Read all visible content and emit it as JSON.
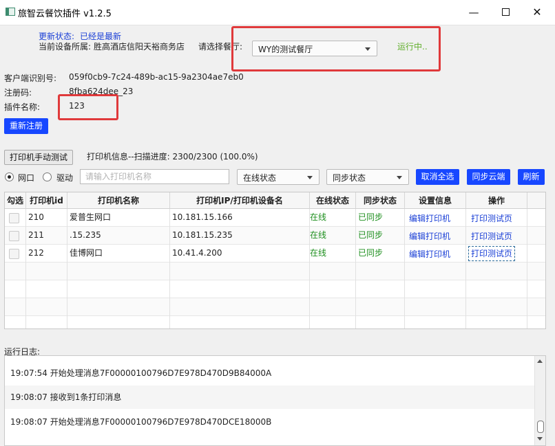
{
  "window": {
    "title": "旅智云餐饮插件 v1.2.5",
    "min_glyph": "—",
    "close_glyph": "✕"
  },
  "status": {
    "update_label": "更新状态:",
    "update_value": "已经是最新",
    "device_label": "当前设备所属:",
    "device_value": "胜高酒店信阳天裕商务店",
    "restaurant_label": "请选择餐厅:",
    "restaurant_selected": "WY的测试餐厅",
    "running_text": "运行中.."
  },
  "info": {
    "client_id_label": "客户端识别号:",
    "client_id_value": "059f0cb9-7c24-489b-ac15-9a2304ae7eb0",
    "reg_code_label": "注册码:",
    "reg_code_value": "8fba624dee_23",
    "plugin_name_label": "插件名称:",
    "plugin_name_value": "123",
    "reregister_label": "重新注册"
  },
  "printer_toolbar": {
    "manual_test_label": "打印机手动测试",
    "scan_info": "打印机信息--扫描进度: 2300/2300 (100.0%)",
    "radio_network": "网口",
    "radio_driver": "驱动",
    "radio_selected": "network",
    "search_placeholder": "请输入打印机名称",
    "online_filter": "在线状态",
    "sync_filter": "同步状态",
    "deselect_all_label": "取消全选",
    "sync_cloud_label": "同步云端",
    "refresh_label": "刷新"
  },
  "table": {
    "headers": [
      "勾选",
      "打印机id",
      "打印机名称",
      "打印机IP/打印机设备名",
      "在线状态",
      "同步状态",
      "设置信息",
      "操作"
    ],
    "rows": [
      {
        "id": "210",
        "name": "爱普生网口",
        "ip": "10.181.15.166",
        "online": "在线",
        "sync": "已同步",
        "settings": "编辑打印机",
        "action": "打印测试页"
      },
      {
        "id": "211",
        "name": ".15.235",
        "ip": "10.181.15.235",
        "online": "在线",
        "sync": "已同步",
        "settings": "编辑打印机",
        "action": "打印测试页"
      },
      {
        "id": "212",
        "name": "佳博网口",
        "ip": "10.41.4.200",
        "online": "在线",
        "sync": "已同步",
        "settings": "编辑打印机",
        "action": "打印测试页"
      }
    ]
  },
  "log": {
    "label": "运行日志:",
    "entries": [
      "19:07:54 开始处理消息7F00000100796D7E978D470D9B84000A",
      "19:08:07 接收到1条打印消息",
      "19:08:07 开始处理消息7F00000100796D7E978D470DCE18000B"
    ]
  },
  "colors": {
    "accent_blue": "#1747ff",
    "status_green": "#1e8f1e",
    "highlight_red": "#e0393b"
  }
}
